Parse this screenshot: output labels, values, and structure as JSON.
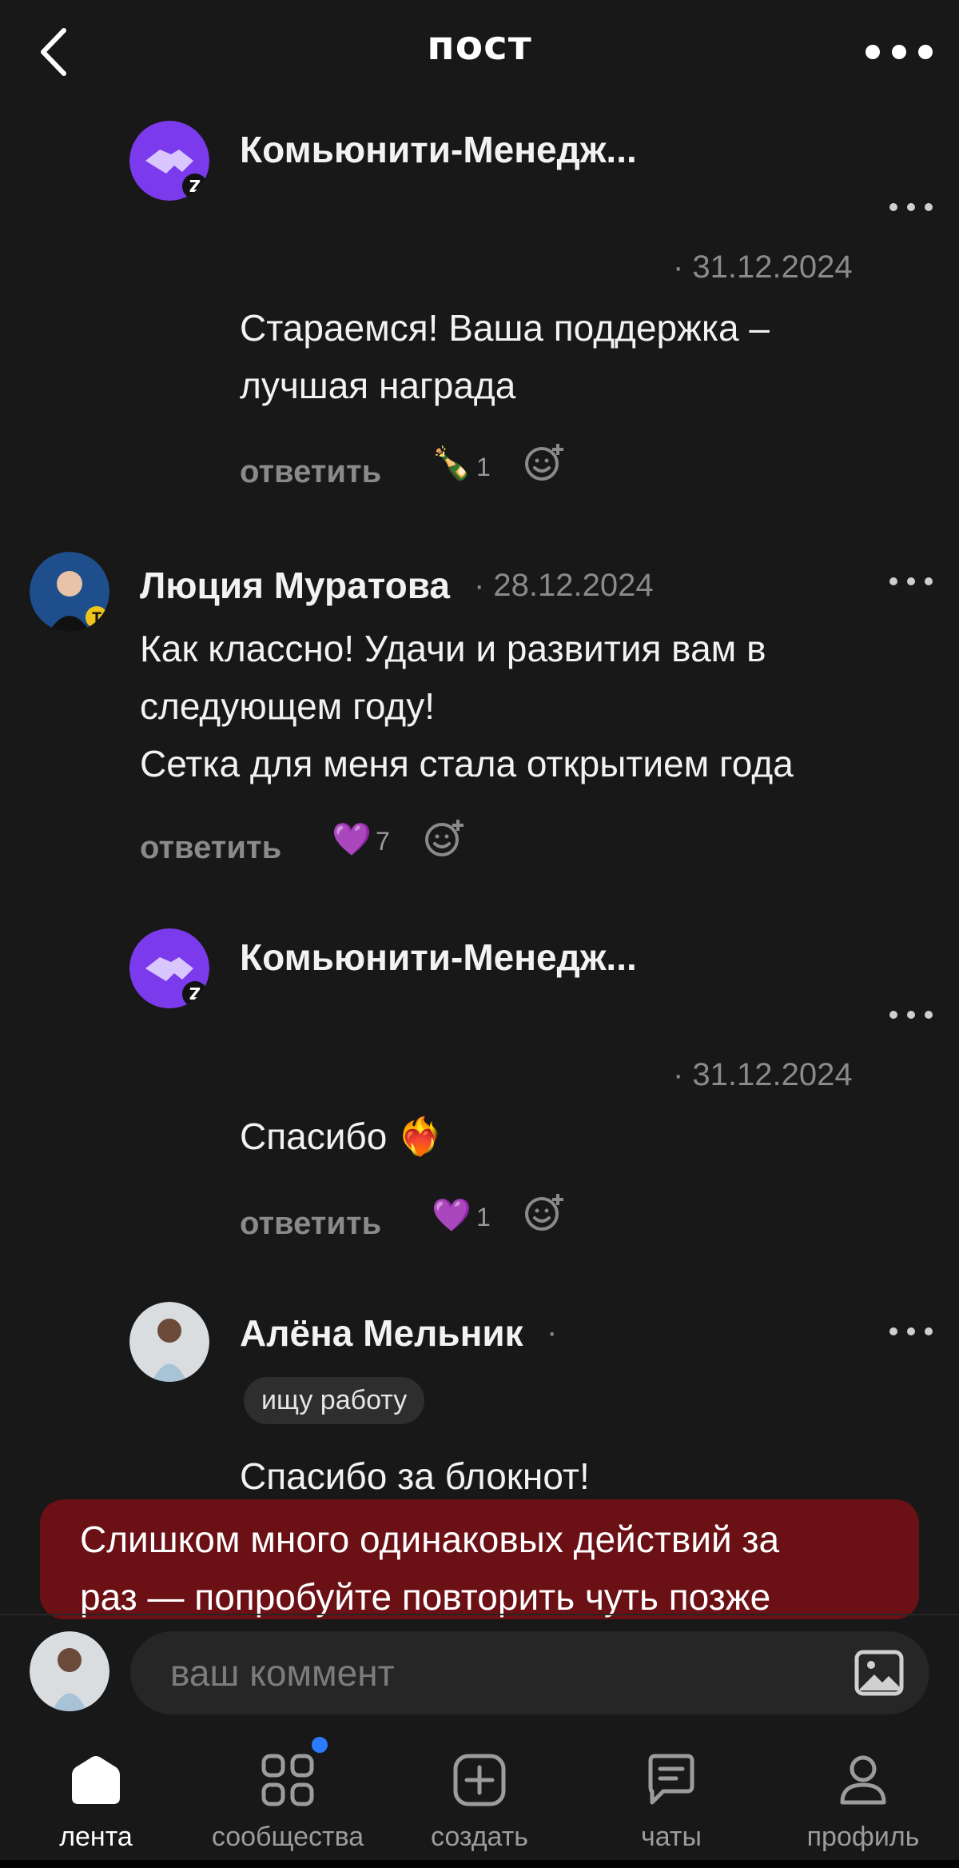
{
  "header": {
    "title": "пост",
    "back_icon": "chevron-left-icon",
    "more_icon": "more-horizontal-icon"
  },
  "comments": [
    {
      "author": "Комьюнити-Менедж...",
      "date": "· 31.12.2024",
      "lines": [
        "Стараемся! Ваша поддержка –",
        "лучшая награда"
      ],
      "reply_label": "ответить",
      "reaction_emoji": "🍾",
      "reaction_count": "1"
    },
    {
      "author": "Люция Муратова",
      "date": "· 28.12.2024",
      "lines": [
        "Как классно! Удачи и развития вам в",
        "следующем году!",
        "Сетка для меня стала открытием года"
      ],
      "reply_label": "ответить",
      "reaction_emoji": "💜",
      "reaction_count": "7"
    },
    {
      "author": "Комьюнити-Менедж...",
      "date": "· 31.12.2024",
      "text": "Спасибо",
      "emoji": "❤️‍🔥",
      "reply_label": "ответить",
      "reaction_emoji": "💜",
      "reaction_count": "1"
    },
    {
      "author": "Алёна Мельник",
      "date_sep": "·",
      "tag": "ищу работу",
      "text": "Спасибо за блокнот!"
    }
  ],
  "toast": {
    "lines": [
      "Слишком много одинаковых действий за",
      "раз — попробуйте повторить чуть позже"
    ],
    "color": "#6b1014"
  },
  "composer": {
    "placeholder": "ваш коммент",
    "attach_icon": "image-icon"
  },
  "bottom_nav": [
    {
      "label": "лента",
      "icon": "home-icon",
      "active": true
    },
    {
      "label": "сообщества",
      "icon": "grid-icon",
      "badge": true
    },
    {
      "label": "создать",
      "icon": "plus-square-icon"
    },
    {
      "label": "чаты",
      "icon": "chat-icon"
    },
    {
      "label": "профиль",
      "icon": "user-icon"
    }
  ],
  "colors": {
    "background": "#181818",
    "accent_purple": "#7c3aed",
    "badge_blue": "#2a7bff",
    "muted_text": "#8a8a8a"
  }
}
